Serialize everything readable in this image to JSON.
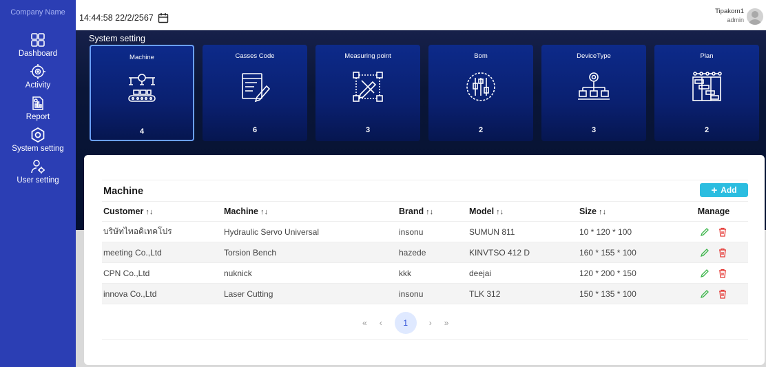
{
  "sidebar": {
    "company": "Company Name",
    "items": [
      {
        "label": "Dashboard",
        "icon": "dashboard-icon"
      },
      {
        "label": "Activity",
        "icon": "activity-icon"
      },
      {
        "label": "Report",
        "icon": "report-icon"
      },
      {
        "label": "System setting",
        "icon": "system-setting-icon"
      },
      {
        "label": "User setting",
        "icon": "user-setting-icon"
      }
    ]
  },
  "header": {
    "datetime": "14:44:58 22/2/2567",
    "user_name": "Tipakorn1",
    "user_role": "admin"
  },
  "hero": {
    "title": "System setting",
    "cards": [
      {
        "title": "Machine",
        "count": "4",
        "icon": "machine-icon"
      },
      {
        "title": "Casses Code",
        "count": "6",
        "icon": "cases-code-icon"
      },
      {
        "title": "Measuring point",
        "count": "3",
        "icon": "measuring-point-icon"
      },
      {
        "title": "Bom",
        "count": "2",
        "icon": "bom-icon"
      },
      {
        "title": "DeviceType",
        "count": "3",
        "icon": "device-type-icon"
      },
      {
        "title": "Plan",
        "count": "2",
        "icon": "plan-icon"
      }
    ]
  },
  "panel": {
    "title": "Machine",
    "add_label": "Add",
    "columns": [
      "Customer",
      "Machine",
      "Brand",
      "Model",
      "Size",
      "Manage"
    ],
    "rows": [
      {
        "customer": "บริษัทไทอคิเทคโปร",
        "machine": "Hydraulic Servo Universal",
        "brand": "insonu",
        "model": "SUMUN 811",
        "size": "10 * 120 * 100"
      },
      {
        "customer": "meeting Co.,Ltd",
        "machine": "Torsion Bench",
        "brand": "hazede",
        "model": "KINVTSO 412 D",
        "size": "160 * 155 * 100"
      },
      {
        "customer": "CPN Co.,Ltd",
        "machine": "nuknick",
        "brand": "kkk",
        "model": "deejai",
        "size": "120 * 200 * 150"
      },
      {
        "customer": "innova Co.,Ltd",
        "machine": "Laser Cutting",
        "brand": "insonu",
        "model": "TLK 312",
        "size": "150 * 135 * 100"
      }
    ],
    "pager": {
      "first": "«",
      "prev": "‹",
      "current": "1",
      "next": "›",
      "last": "»"
    }
  },
  "colors": {
    "sidebar": "#2b3eb4",
    "accent": "#2bbde0",
    "edit": "#3bb54a",
    "delete": "#e53935"
  }
}
